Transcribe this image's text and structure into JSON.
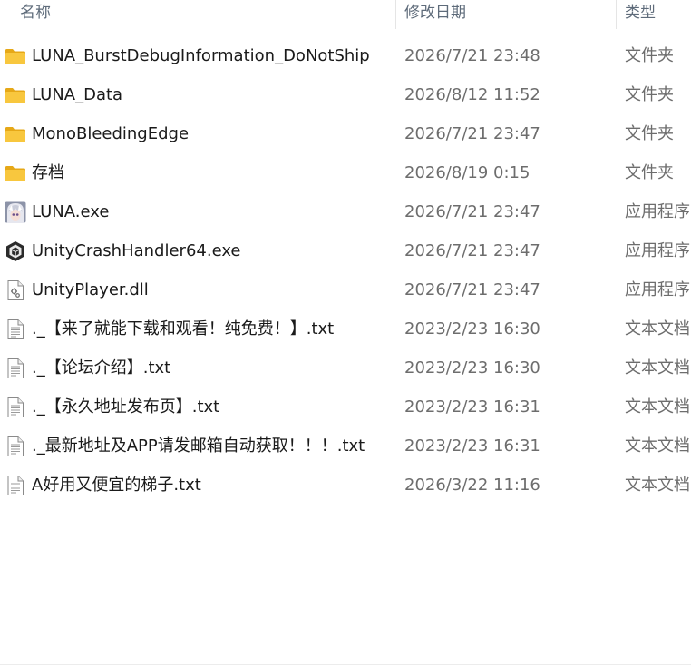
{
  "header": {
    "name_label": "名称",
    "date_label": "修改日期",
    "type_label": "类型"
  },
  "files": [
    {
      "name": "LUNA_BurstDebugInformation_DoNotShip",
      "date": "2026/7/21 23:48",
      "type": "文件夹",
      "icon": "folder-icon"
    },
    {
      "name": "LUNA_Data",
      "date": "2026/8/12 11:52",
      "type": "文件夹",
      "icon": "folder-icon"
    },
    {
      "name": "MonoBleedingEdge",
      "date": "2026/7/21 23:47",
      "type": "文件夹",
      "icon": "folder-icon"
    },
    {
      "name": "存档",
      "date": "2026/8/19 0:15",
      "type": "文件夹",
      "icon": "folder-icon"
    },
    {
      "name": "LUNA.exe",
      "date": "2026/7/21 23:47",
      "type": "应用程序",
      "icon": "app-avatar-icon"
    },
    {
      "name": "UnityCrashHandler64.exe",
      "date": "2026/7/21 23:47",
      "type": "应用程序",
      "icon": "unity-icon"
    },
    {
      "name": "UnityPlayer.dll",
      "date": "2026/7/21 23:47",
      "type": "应用程序",
      "icon": "dll-icon"
    },
    {
      "name": "._【来了就能下载和观看！纯免费！】.txt",
      "date": "2023/2/23 16:30",
      "type": "文本文档",
      "icon": "text-file-icon"
    },
    {
      "name": "._【论坛介绍】.txt",
      "date": "2023/2/23 16:30",
      "type": "文本文档",
      "icon": "text-file-icon"
    },
    {
      "name": "._【永久地址发布页】.txt",
      "date": "2023/2/23 16:31",
      "type": "文本文档",
      "icon": "text-file-icon"
    },
    {
      "name": "._最新地址及APP请发邮箱自动获取！！！.txt",
      "date": "2023/2/23 16:31",
      "type": "文本文档",
      "icon": "text-file-icon"
    },
    {
      "name": "A好用又便宜的梯子.txt",
      "date": "2026/3/22 11:16",
      "type": "文本文档",
      "icon": "text-file-icon"
    }
  ],
  "colors": {
    "folder": "#f8c73e",
    "folder_dark": "#e6a817",
    "header_text": "#5e6b7a",
    "secondary_text": "#6d6d6d"
  }
}
